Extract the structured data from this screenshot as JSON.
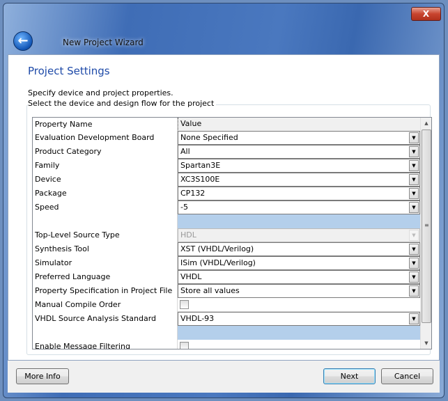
{
  "window": {
    "title": "New Project Wizard",
    "close_label": "X"
  },
  "page": {
    "heading": "Project Settings",
    "description": "Specify device and project properties.",
    "group_label": "Select the device and design flow for the project"
  },
  "table": {
    "headers": [
      "Property Name",
      "Value"
    ],
    "rows": [
      {
        "name": "Evaluation Development Board",
        "value": "None Specified",
        "type": "combo"
      },
      {
        "name": "Product Category",
        "value": "All",
        "type": "combo"
      },
      {
        "name": "Family",
        "value": "Spartan3E",
        "type": "combo"
      },
      {
        "name": "Device",
        "value": "XC3S100E",
        "type": "combo"
      },
      {
        "name": "Package",
        "value": "CP132",
        "type": "combo"
      },
      {
        "name": "Speed",
        "value": "-5",
        "type": "combo"
      },
      {
        "name": "",
        "value": "",
        "type": "sep"
      },
      {
        "name": "Top-Level Source Type",
        "value": "HDL",
        "type": "disabled"
      },
      {
        "name": "Synthesis Tool",
        "value": "XST (VHDL/Verilog)",
        "type": "combo"
      },
      {
        "name": "Simulator",
        "value": "ISim (VHDL/Verilog)",
        "type": "combo"
      },
      {
        "name": "Preferred Language",
        "value": "VHDL",
        "type": "combo"
      },
      {
        "name": "Property Specification in Project File",
        "value": "Store all values",
        "type": "combo"
      },
      {
        "name": "Manual Compile Order",
        "value": "",
        "type": "checkbox",
        "checked": false
      },
      {
        "name": "VHDL Source Analysis Standard",
        "value": "VHDL-93",
        "type": "combo"
      },
      {
        "name": "",
        "value": "",
        "type": "sep"
      },
      {
        "name": "Enable Message Filtering",
        "value": "",
        "type": "checkbox",
        "checked": false
      }
    ]
  },
  "footer": {
    "more_info": "More Info",
    "next": "Next",
    "cancel": "Cancel"
  }
}
